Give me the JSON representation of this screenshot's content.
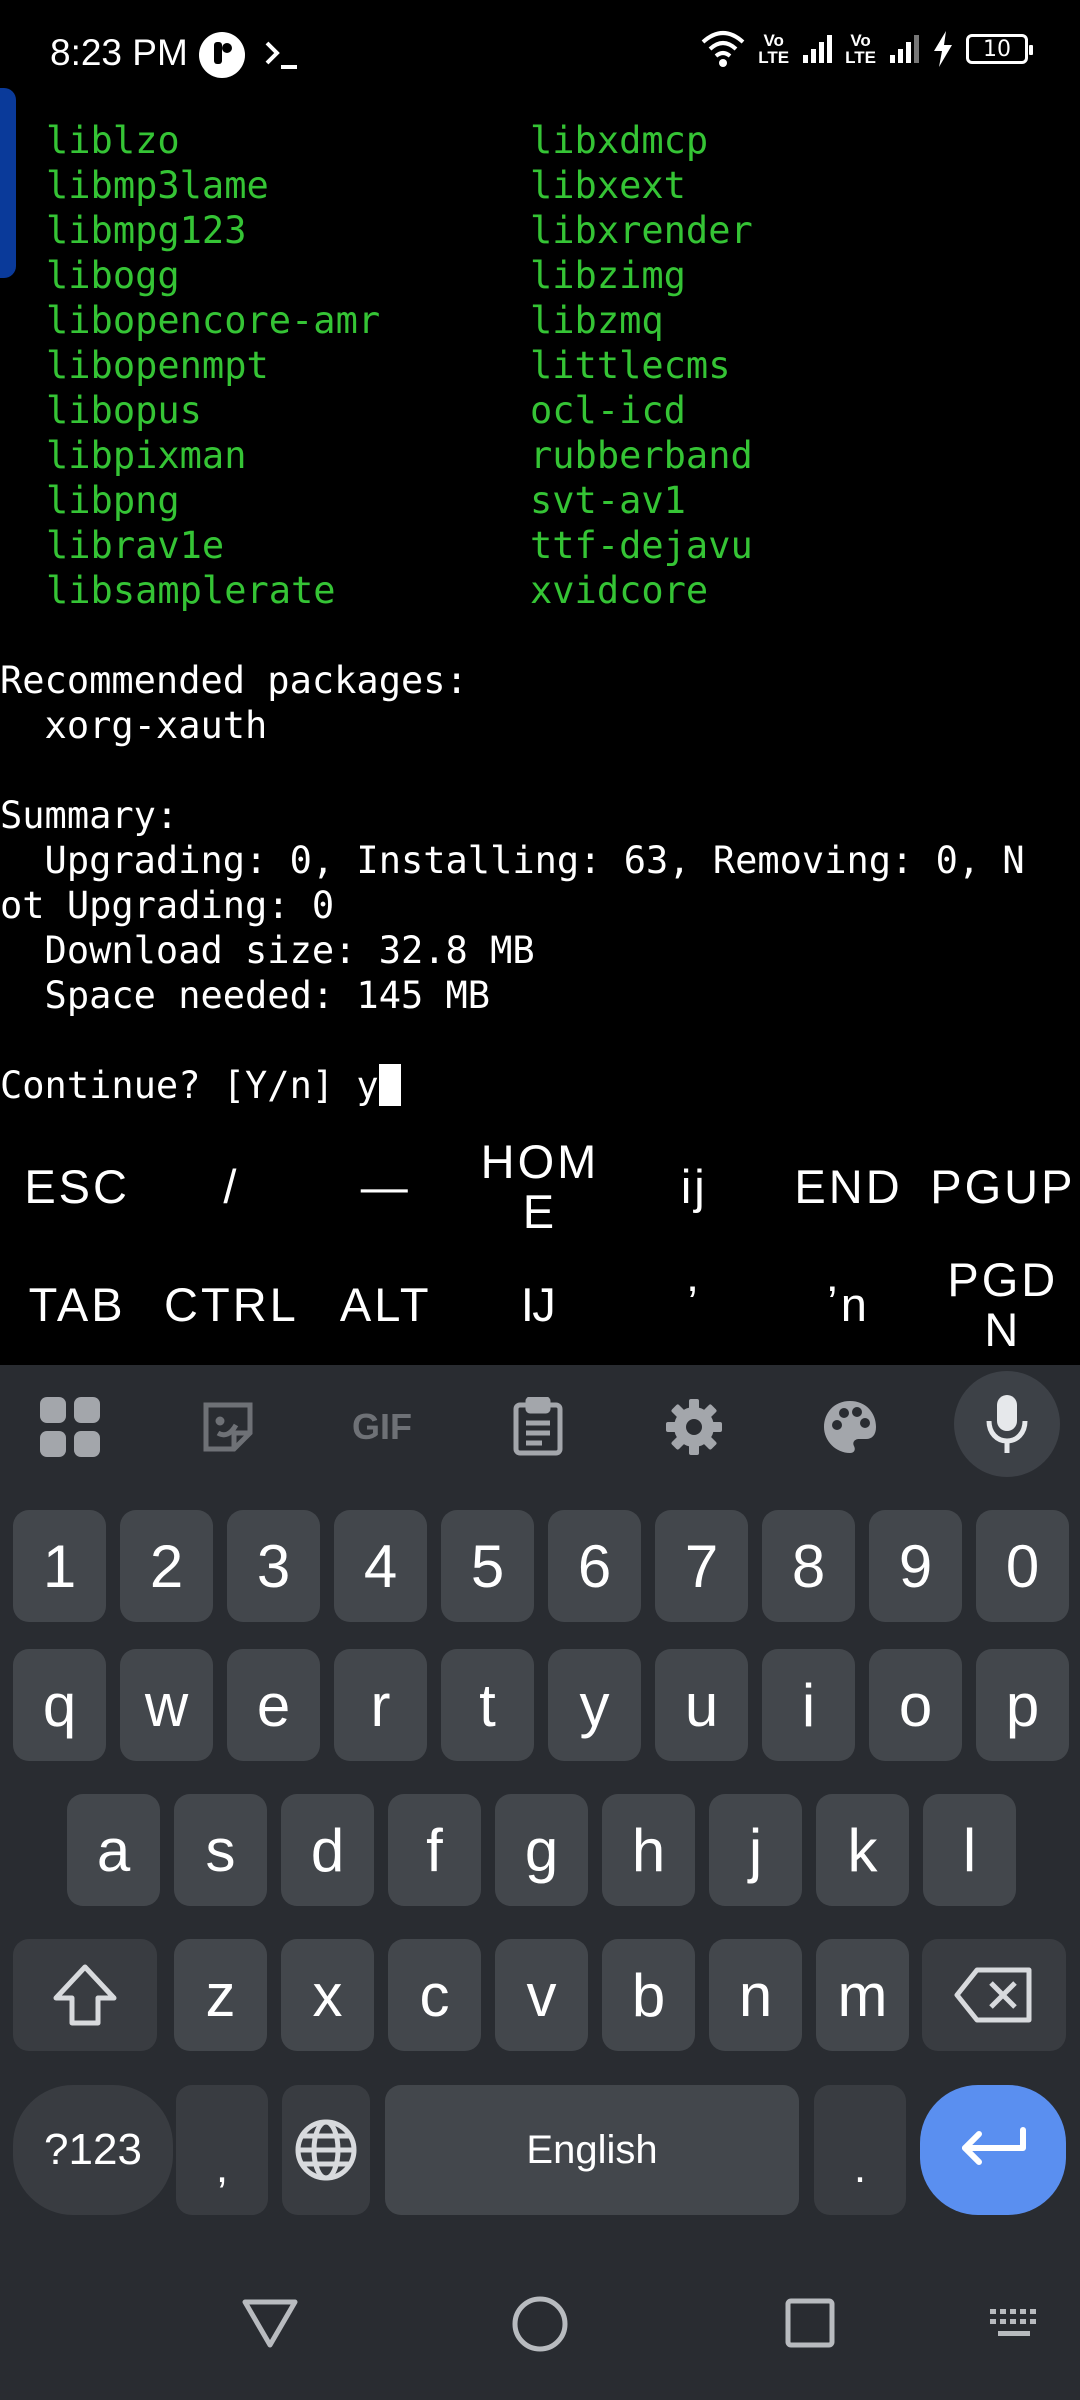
{
  "status_bar": {
    "time": "8:23 PM",
    "net1": "Vo\nLTE",
    "net2": "Vo\nLTE",
    "battery": "10"
  },
  "terminal": {
    "packages_left": [
      "liblzo",
      "libmp3lame",
      "libmpg123",
      "libogg",
      "libopencore-amr",
      "libopenmpt",
      "libopus",
      "libpixman",
      "libpng",
      "librav1e",
      "libsamplerate"
    ],
    "packages_right": [
      "libxdmcp",
      "libxext",
      "libxrender",
      "libzimg",
      "libzmq",
      "littlecms",
      "ocl-icd",
      "rubberband",
      "svt-av1",
      "ttf-dejavu",
      "xvidcore"
    ],
    "lines": [
      "",
      "Recommended packages:",
      "  xorg-xauth",
      "",
      "Summary:",
      "  Upgrading: 0, Installing: 63, Removing: 0, N",
      "ot Upgrading: 0",
      "  Download size: 32.8 MB",
      "  Space needed: 145 MB",
      ""
    ],
    "prompt": "Continue? [Y/n] ",
    "input": "y"
  },
  "extra_keys": {
    "row1": [
      "ESC",
      "/",
      "—",
      "HOM\nE",
      "ij",
      "END",
      "PGUP"
    ],
    "row2": [
      "TAB",
      "CTRL",
      "ALT",
      "Ĳ",
      "ʼ",
      "ʼn",
      "PGD\nN"
    ]
  },
  "keyboard": {
    "numbers": [
      "1",
      "2",
      "3",
      "4",
      "5",
      "6",
      "7",
      "8",
      "9",
      "0"
    ],
    "row_q": [
      "q",
      "w",
      "e",
      "r",
      "t",
      "y",
      "u",
      "i",
      "o",
      "p"
    ],
    "row_a": [
      "a",
      "s",
      "d",
      "f",
      "g",
      "h",
      "j",
      "k",
      "l"
    ],
    "row_z": [
      "z",
      "x",
      "c",
      "v",
      "b",
      "n",
      "m"
    ],
    "symbols_label": "?123",
    "comma": ",",
    "space_label": "English",
    "period": "."
  }
}
